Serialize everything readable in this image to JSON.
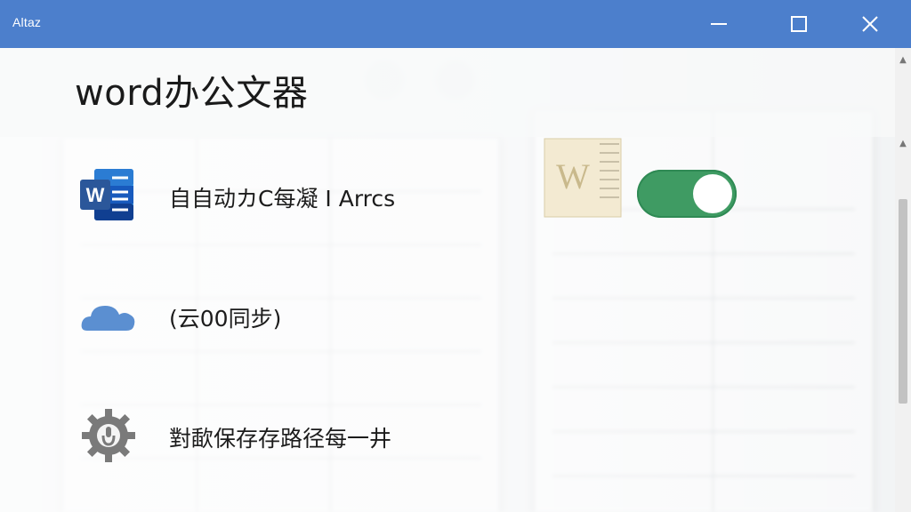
{
  "window": {
    "title": "Altaz"
  },
  "app_title": "word办公文器",
  "settings": [
    {
      "label": "自自动カC每凝 I Arrcs",
      "icon": "word-icon",
      "has_toggle": true,
      "toggle_on": true
    },
    {
      "label": "(云00同步)",
      "icon": "cloud-icon"
    },
    {
      "label": "對歃保存存路径每一井",
      "icon": "settings-gear-icon"
    }
  ],
  "colors": {
    "titlebar": "#4c7fcc",
    "toggle_on": "#3f9b63",
    "word_blue": "#2b579a",
    "cloud_blue": "#5b8fd1",
    "gear_gray": "#7a7a7a"
  }
}
